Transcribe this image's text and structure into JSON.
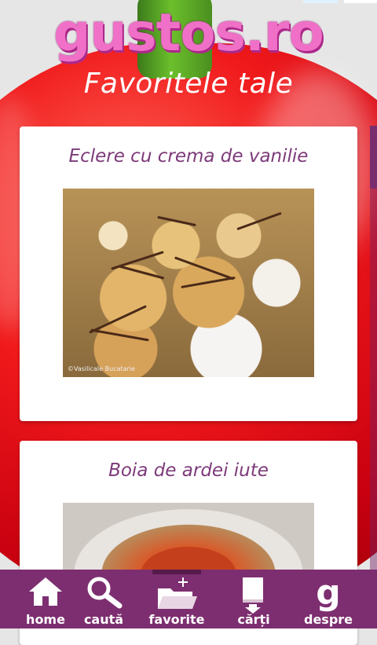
{
  "app": {
    "logo_text": "gustos.ro",
    "page_title": "Favoritele tale"
  },
  "cards": [
    {
      "title": "Eclere cu crema de vanilie",
      "image_alt": "Eclere cu crema de vanilie",
      "watermark": "©Vasilicale Bucatarie"
    },
    {
      "title": "Boia de ardei iute",
      "image_alt": "Boia de ardei iute"
    }
  ],
  "nav": {
    "home": "home",
    "cauta": "caută",
    "favorite": "favorite",
    "carti": "cărți",
    "despre": "despre",
    "despre_glyph": "g",
    "selected": "favorite"
  },
  "colors": {
    "brand_purple": "#7d2e70",
    "title_purple": "#7d3a7a",
    "logo_pink": "#f070c8"
  }
}
